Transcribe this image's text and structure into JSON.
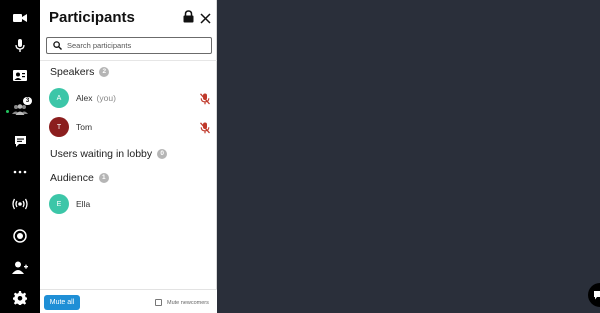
{
  "toolbar": {
    "participants_badge": "3"
  },
  "panel": {
    "title": "Participants",
    "search_placeholder": "Search participants",
    "speakers": {
      "label": "Speakers",
      "count": "2",
      "items": [
        {
          "initial": "A",
          "name": "Alex",
          "tag": "(you)",
          "color": "#3cc6a8"
        },
        {
          "initial": "T",
          "name": "Tom",
          "tag": "",
          "color": "#8b1e1e"
        }
      ]
    },
    "lobby": {
      "label": "Users waiting in lobby",
      "count": "0"
    },
    "audience": {
      "label": "Audience",
      "count": "1",
      "items": [
        {
          "initial": "E",
          "name": "Ella",
          "color": "#3cc6a8"
        }
      ]
    },
    "footer": {
      "mute_all": "Mute all",
      "mute_newcomers": "Mute newcomers"
    }
  },
  "colors": {
    "stage_bg": "#2a2f3a",
    "accent": "#1f8fd6",
    "muted_red": "#c0392b"
  }
}
